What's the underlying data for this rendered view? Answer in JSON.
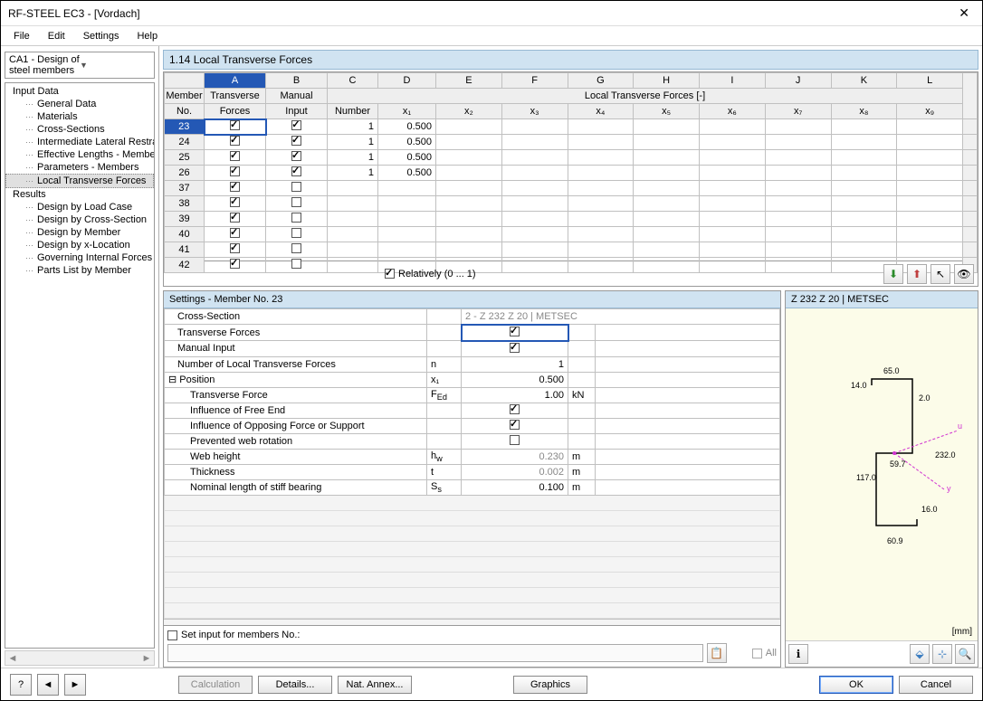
{
  "window": {
    "title": "RF-STEEL EC3 - [Vordach]"
  },
  "menu": [
    "File",
    "Edit",
    "Settings",
    "Help"
  ],
  "combo": "CA1 - Design of steel members",
  "tree": {
    "input_label": "Input Data",
    "input": [
      "General Data",
      "Materials",
      "Cross-Sections",
      "Intermediate Lateral Restraints",
      "Effective Lengths - Members",
      "Parameters - Members",
      "Local Transverse Forces"
    ],
    "results_label": "Results",
    "results": [
      "Design by Load Case",
      "Design by Cross-Section",
      "Design by Member",
      "Design by x-Location",
      "Governing Internal Forces by Member",
      "Parts List by Member"
    ]
  },
  "heading": "1.14 Local Transverse Forces",
  "grid": {
    "cols_top": [
      "",
      "A",
      "B",
      "C",
      "D",
      "E",
      "F",
      "G",
      "H",
      "I",
      "J",
      "K",
      "L"
    ],
    "h1": [
      "Member",
      "Transverse",
      "Manual",
      "",
      "",
      "",
      "",
      "Local Transverse Forces [-]",
      "",
      "",
      "",
      "",
      ""
    ],
    "h2": [
      "No.",
      "Forces",
      "Input",
      "Number",
      "x₁",
      "x₂",
      "x₃",
      "x₄",
      "x₅",
      "x₆",
      "x₇",
      "x₈",
      "x₉"
    ],
    "rows": [
      {
        "no": "23",
        "tf": true,
        "mi": true,
        "num": "1",
        "x1": "0.500"
      },
      {
        "no": "24",
        "tf": true,
        "mi": true,
        "num": "1",
        "x1": "0.500"
      },
      {
        "no": "25",
        "tf": true,
        "mi": true,
        "num": "1",
        "x1": "0.500"
      },
      {
        "no": "26",
        "tf": true,
        "mi": true,
        "num": "1",
        "x1": "0.500"
      },
      {
        "no": "37",
        "tf": true,
        "mi": false,
        "num": "",
        "x1": ""
      },
      {
        "no": "38",
        "tf": true,
        "mi": false,
        "num": "",
        "x1": ""
      },
      {
        "no": "39",
        "tf": true,
        "mi": false,
        "num": "",
        "x1": ""
      },
      {
        "no": "40",
        "tf": true,
        "mi": false,
        "num": "",
        "x1": ""
      },
      {
        "no": "41",
        "tf": true,
        "mi": false,
        "num": "",
        "x1": ""
      },
      {
        "no": "42",
        "tf": true,
        "mi": false,
        "num": "",
        "x1": ""
      }
    ],
    "relatively": "Relatively (0 ... 1)"
  },
  "settings": {
    "title": "Settings - Member No. 23",
    "rows": [
      {
        "l": "Cross-Section",
        "ind": 1,
        "sym": "",
        "val": "2 - Z 232 Z 20 | METSEC",
        "u": "",
        "span": true,
        "dim": true
      },
      {
        "l": "Transverse Forces",
        "ind": 1,
        "sym": "",
        "val": "cb_on",
        "u": ""
      },
      {
        "l": "Manual Input",
        "ind": 1,
        "sym": "",
        "val": "cb_on",
        "u": ""
      },
      {
        "l": "Number of Local Transverse Forces",
        "ind": 1,
        "sym": "n",
        "val": "1",
        "u": ""
      },
      {
        "l": "Position",
        "ind": 0,
        "sym": "x₁",
        "val": "0.500",
        "u": "",
        "tree": true
      },
      {
        "l": "Transverse Force",
        "ind": 2,
        "sym": "F_Ed",
        "val": "1.00",
        "u": "kN"
      },
      {
        "l": "Influence of Free End",
        "ind": 2,
        "sym": "",
        "val": "cb_on",
        "u": ""
      },
      {
        "l": "Influence of Opposing Force or Support",
        "ind": 2,
        "sym": "",
        "val": "cb_on",
        "u": ""
      },
      {
        "l": "Prevented web rotation",
        "ind": 2,
        "sym": "",
        "val": "cb_off",
        "u": ""
      },
      {
        "l": "Web height",
        "ind": 2,
        "sym": "h_w",
        "val": "0.230",
        "u": "m",
        "dim": true
      },
      {
        "l": "Thickness",
        "ind": 2,
        "sym": "t",
        "val": "0.002",
        "u": "m",
        "dim": true
      },
      {
        "l": "Nominal length of stiff bearing",
        "ind": 2,
        "sym": "S_s",
        "val": "0.100",
        "u": "m"
      }
    ],
    "setinput_label": "Set input for members No.:",
    "all": "All"
  },
  "preview": {
    "title": "Z 232 Z 20 | METSEC",
    "mm": "[mm]",
    "dims": {
      "top": "65.0",
      "left_top": "14.0",
      "gap": "2.0",
      "height": "117.0",
      "total": "232.0",
      "mid": "59.7",
      "bot_r": "16.0",
      "bot": "60.9"
    }
  },
  "buttons": {
    "calc": "Calculation",
    "details": "Details...",
    "annex": "Nat. Annex...",
    "graphics": "Graphics",
    "ok": "OK",
    "cancel": "Cancel"
  }
}
